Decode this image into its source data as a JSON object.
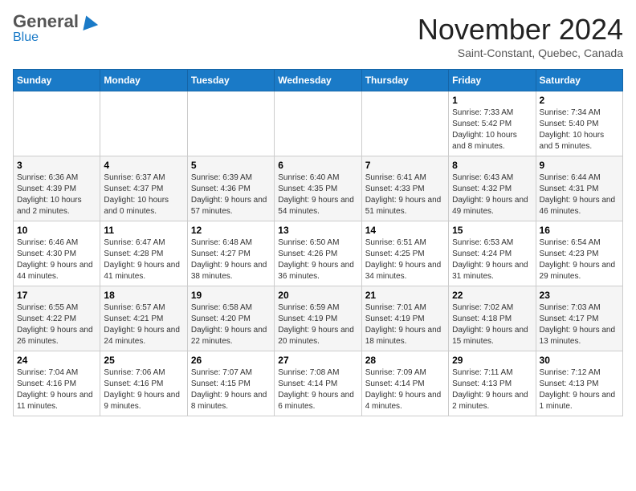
{
  "logo": {
    "general": "General",
    "blue": "Blue"
  },
  "header": {
    "month": "November 2024",
    "location": "Saint-Constant, Quebec, Canada"
  },
  "weekdays": [
    "Sunday",
    "Monday",
    "Tuesday",
    "Wednesday",
    "Thursday",
    "Friday",
    "Saturday"
  ],
  "weeks": [
    [
      {
        "day": "",
        "info": ""
      },
      {
        "day": "",
        "info": ""
      },
      {
        "day": "",
        "info": ""
      },
      {
        "day": "",
        "info": ""
      },
      {
        "day": "",
        "info": ""
      },
      {
        "day": "1",
        "info": "Sunrise: 7:33 AM\nSunset: 5:42 PM\nDaylight: 10 hours and 8 minutes."
      },
      {
        "day": "2",
        "info": "Sunrise: 7:34 AM\nSunset: 5:40 PM\nDaylight: 10 hours and 5 minutes."
      }
    ],
    [
      {
        "day": "3",
        "info": "Sunrise: 6:36 AM\nSunset: 4:39 PM\nDaylight: 10 hours and 2 minutes."
      },
      {
        "day": "4",
        "info": "Sunrise: 6:37 AM\nSunset: 4:37 PM\nDaylight: 10 hours and 0 minutes."
      },
      {
        "day": "5",
        "info": "Sunrise: 6:39 AM\nSunset: 4:36 PM\nDaylight: 9 hours and 57 minutes."
      },
      {
        "day": "6",
        "info": "Sunrise: 6:40 AM\nSunset: 4:35 PM\nDaylight: 9 hours and 54 minutes."
      },
      {
        "day": "7",
        "info": "Sunrise: 6:41 AM\nSunset: 4:33 PM\nDaylight: 9 hours and 51 minutes."
      },
      {
        "day": "8",
        "info": "Sunrise: 6:43 AM\nSunset: 4:32 PM\nDaylight: 9 hours and 49 minutes."
      },
      {
        "day": "9",
        "info": "Sunrise: 6:44 AM\nSunset: 4:31 PM\nDaylight: 9 hours and 46 minutes."
      }
    ],
    [
      {
        "day": "10",
        "info": "Sunrise: 6:46 AM\nSunset: 4:30 PM\nDaylight: 9 hours and 44 minutes."
      },
      {
        "day": "11",
        "info": "Sunrise: 6:47 AM\nSunset: 4:28 PM\nDaylight: 9 hours and 41 minutes."
      },
      {
        "day": "12",
        "info": "Sunrise: 6:48 AM\nSunset: 4:27 PM\nDaylight: 9 hours and 38 minutes."
      },
      {
        "day": "13",
        "info": "Sunrise: 6:50 AM\nSunset: 4:26 PM\nDaylight: 9 hours and 36 minutes."
      },
      {
        "day": "14",
        "info": "Sunrise: 6:51 AM\nSunset: 4:25 PM\nDaylight: 9 hours and 34 minutes."
      },
      {
        "day": "15",
        "info": "Sunrise: 6:53 AM\nSunset: 4:24 PM\nDaylight: 9 hours and 31 minutes."
      },
      {
        "day": "16",
        "info": "Sunrise: 6:54 AM\nSunset: 4:23 PM\nDaylight: 9 hours and 29 minutes."
      }
    ],
    [
      {
        "day": "17",
        "info": "Sunrise: 6:55 AM\nSunset: 4:22 PM\nDaylight: 9 hours and 26 minutes."
      },
      {
        "day": "18",
        "info": "Sunrise: 6:57 AM\nSunset: 4:21 PM\nDaylight: 9 hours and 24 minutes."
      },
      {
        "day": "19",
        "info": "Sunrise: 6:58 AM\nSunset: 4:20 PM\nDaylight: 9 hours and 22 minutes."
      },
      {
        "day": "20",
        "info": "Sunrise: 6:59 AM\nSunset: 4:19 PM\nDaylight: 9 hours and 20 minutes."
      },
      {
        "day": "21",
        "info": "Sunrise: 7:01 AM\nSunset: 4:19 PM\nDaylight: 9 hours and 18 minutes."
      },
      {
        "day": "22",
        "info": "Sunrise: 7:02 AM\nSunset: 4:18 PM\nDaylight: 9 hours and 15 minutes."
      },
      {
        "day": "23",
        "info": "Sunrise: 7:03 AM\nSunset: 4:17 PM\nDaylight: 9 hours and 13 minutes."
      }
    ],
    [
      {
        "day": "24",
        "info": "Sunrise: 7:04 AM\nSunset: 4:16 PM\nDaylight: 9 hours and 11 minutes."
      },
      {
        "day": "25",
        "info": "Sunrise: 7:06 AM\nSunset: 4:16 PM\nDaylight: 9 hours and 9 minutes."
      },
      {
        "day": "26",
        "info": "Sunrise: 7:07 AM\nSunset: 4:15 PM\nDaylight: 9 hours and 8 minutes."
      },
      {
        "day": "27",
        "info": "Sunrise: 7:08 AM\nSunset: 4:14 PM\nDaylight: 9 hours and 6 minutes."
      },
      {
        "day": "28",
        "info": "Sunrise: 7:09 AM\nSunset: 4:14 PM\nDaylight: 9 hours and 4 minutes."
      },
      {
        "day": "29",
        "info": "Sunrise: 7:11 AM\nSunset: 4:13 PM\nDaylight: 9 hours and 2 minutes."
      },
      {
        "day": "30",
        "info": "Sunrise: 7:12 AM\nSunset: 4:13 PM\nDaylight: 9 hours and 1 minute."
      }
    ]
  ]
}
